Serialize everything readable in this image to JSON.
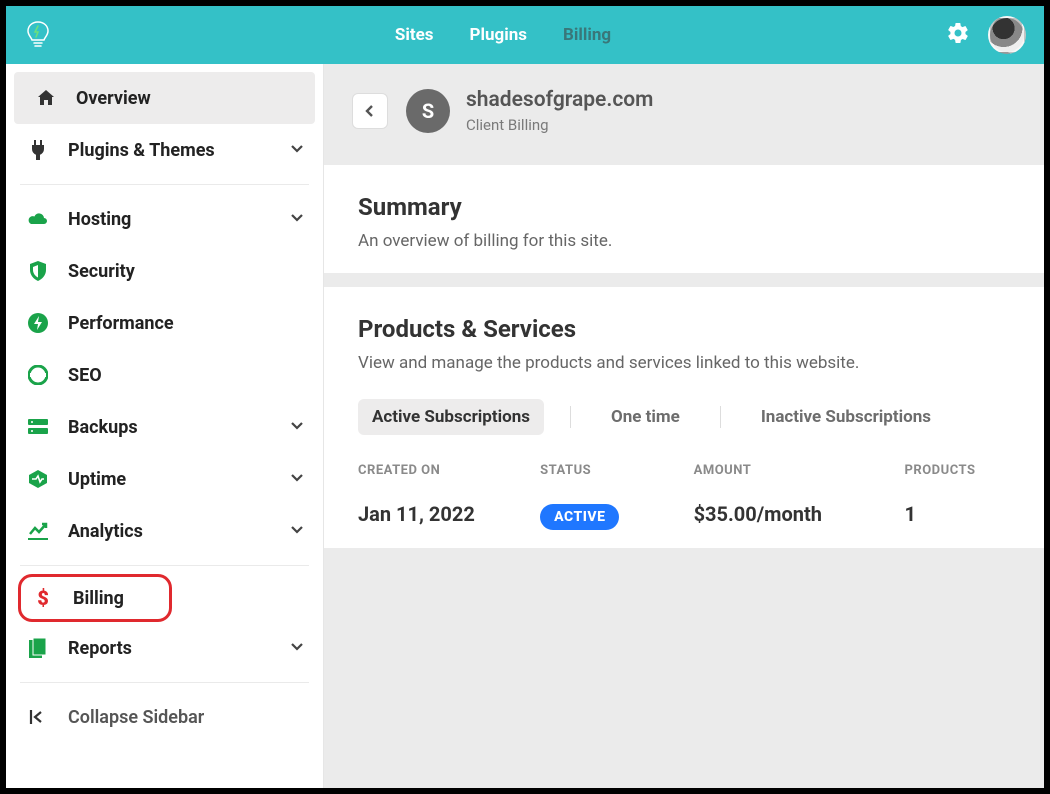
{
  "topnav": {
    "items": [
      {
        "label": "Sites",
        "active": false
      },
      {
        "label": "Plugins",
        "active": false
      },
      {
        "label": "Billing",
        "active": true
      }
    ]
  },
  "sidebar": {
    "overview": "Overview",
    "plugins_themes": "Plugins & Themes",
    "hosting": "Hosting",
    "security": "Security",
    "performance": "Performance",
    "seo": "SEO",
    "backups": "Backups",
    "uptime": "Uptime",
    "analytics": "Analytics",
    "billing": "Billing",
    "reports": "Reports",
    "collapse": "Collapse Sidebar"
  },
  "header": {
    "site_initial": "S",
    "site_name": "shadesofgrape.com",
    "breadcrumb": "Client Billing"
  },
  "summary": {
    "title": "Summary",
    "desc": "An overview of billing for this site."
  },
  "products": {
    "title": "Products & Services",
    "desc": "View and manage the products and services linked to this website.",
    "tabs": {
      "active_subs": "Active Subscriptions",
      "one_time": "One time",
      "inactive_subs": "Inactive Subscriptions"
    },
    "columns": {
      "created": "CREATED ON",
      "status": "STATUS",
      "amount": "AMOUNT",
      "products": "PRODUCTS"
    },
    "rows": [
      {
        "created": "Jan 11, 2022",
        "status_label": "ACTIVE",
        "amount": "$35.00/month",
        "products": "1"
      }
    ]
  }
}
